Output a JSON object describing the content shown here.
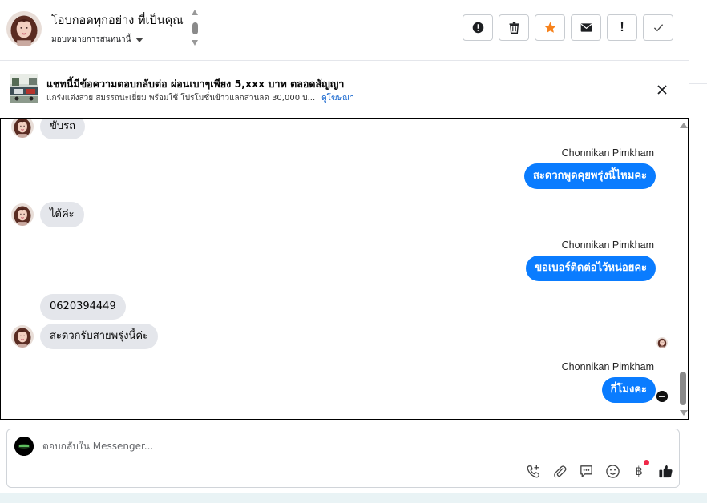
{
  "header": {
    "conversation_name": "โอบกอดทุกอย่าง ที่เป็นคุณ",
    "assign_label": "มอบหมายการสนทนานี้",
    "actions": [
      {
        "name": "spam",
        "icon": "alert-circle-icon"
      },
      {
        "name": "delete",
        "icon": "trash-icon"
      },
      {
        "name": "star",
        "icon": "star-icon",
        "color": "#f7821b"
      },
      {
        "name": "mark-unread",
        "icon": "envelope-icon"
      },
      {
        "name": "follow-up",
        "icon": "exclamation-icon",
        "glyph": "!"
      },
      {
        "name": "done",
        "icon": "check-icon"
      }
    ]
  },
  "ad": {
    "title": "แชทนี้มีข้อความตอบกลับต่อ ผ่อนเบาๆเพียง 5,xxx บาท ตลอดสัญญา",
    "subtitle": "แกร่งแต่งสวย สมรรถนะเยี่ยม พร้อมใช้ โปรโมชั่นข้าวแลกส่วนลด 30,000 บ...",
    "link": "ดูโฆษณา"
  },
  "messages": {
    "in_1": "ขับรถ",
    "out_1_sender": "Chonnikan Pimkham",
    "out_1": "สะดวกพูดคุยพรุ่งนี้ไหมคะ",
    "in_2": "ได้ค่ะ",
    "out_2_sender": "Chonnikan Pimkham",
    "out_2": "ขอเบอร์ติดต่อไว้หน่อยคะ",
    "in_3": "0620394449",
    "in_4": "สะดวกรับสายพรุ่งนี้ค่ะ",
    "out_3_sender": "Chonnikan Pimkham",
    "out_3": "กี่โมงคะ"
  },
  "composer": {
    "placeholder": "ตอบกลับใน Messenger...",
    "tools": [
      "call-add-icon",
      "paperclip-icon",
      "chat-bubble-icon",
      "smiley-icon",
      "baht-icon",
      "thumbs-up-icon"
    ],
    "baht_glyph": "฿"
  },
  "colors": {
    "outgoing_bubble": "#0a7cff",
    "incoming_bubble": "#e4e6eb",
    "link": "#0a5ecc"
  }
}
